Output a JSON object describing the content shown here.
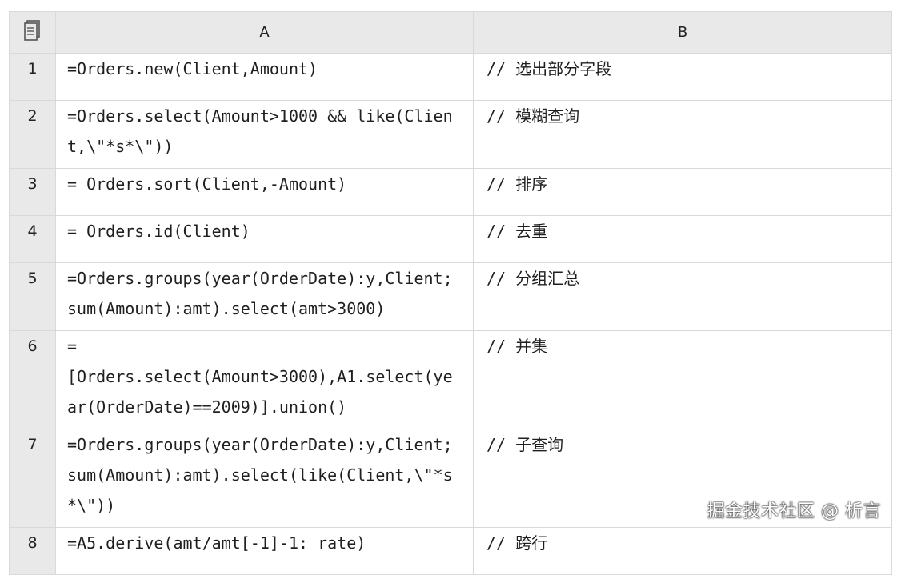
{
  "header": {
    "corner_icon": "sheet-icon",
    "col_a": "A",
    "col_b": "B"
  },
  "rows": [
    {
      "num": "1",
      "code": "=Orders.new(Client,Amount)",
      "comment": "// 选出部分字段"
    },
    {
      "num": "2",
      "code": "=Orders.select(Amount>1000 && like(Client,\\\"*s*\\\"))",
      "comment": "// 模糊查询"
    },
    {
      "num": "3",
      "code": "= Orders.sort(Client,-Amount)",
      "comment": "// 排序"
    },
    {
      "num": "4",
      "code": "= Orders.id(Client)",
      "comment": "// 去重"
    },
    {
      "num": "5",
      "code": "=Orders.groups(year(OrderDate):y,Client;sum(Amount):amt).select(amt>3000)",
      "comment": "// 分组汇总"
    },
    {
      "num": "6",
      "code": "=\n[Orders.select(Amount>3000),A1.select(year(OrderDate)==2009)].union()",
      "comment": "// 并集"
    },
    {
      "num": "7",
      "code": "=Orders.groups(year(OrderDate):y,Client;sum(Amount):amt).select(like(Client,\\\"*s*\\\"))",
      "comment": "// 子查询"
    },
    {
      "num": "8",
      "code": "=A5.derive(amt/amt[-1]-1: rate)",
      "comment": "// 跨行"
    }
  ],
  "watermark": "掘金技术社区 @ 析言"
}
